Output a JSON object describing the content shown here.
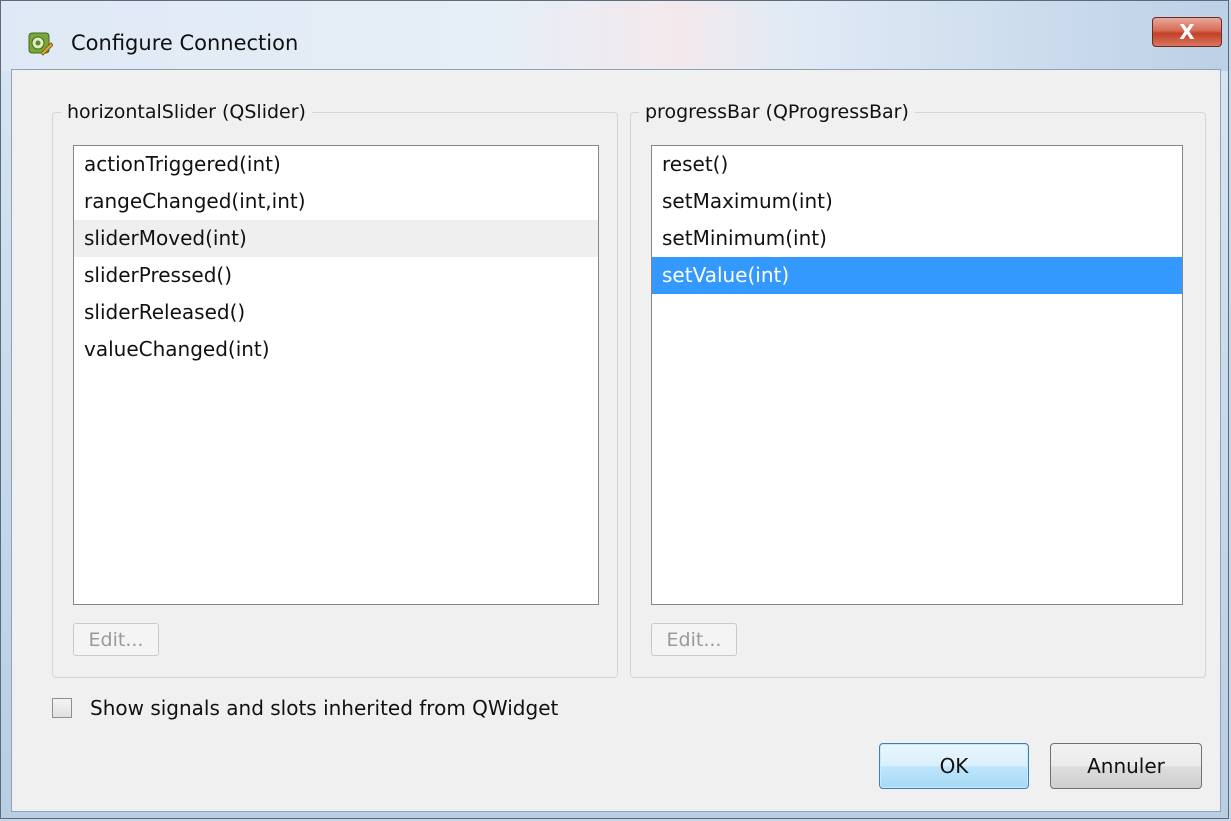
{
  "window": {
    "title": "Configure Connection",
    "close_label": "X"
  },
  "left_group": {
    "title": "horizontalSlider (QSlider)",
    "items": [
      "actionTriggered(int)",
      "rangeChanged(int,int)",
      "sliderMoved(int)",
      "sliderPressed()",
      "sliderReleased()",
      "valueChanged(int)"
    ],
    "hover_index": 2,
    "edit_label": "Edit..."
  },
  "right_group": {
    "title": "progressBar (QProgressBar)",
    "items": [
      "reset()",
      "setMaximum(int)",
      "setMinimum(int)",
      "setValue(int)"
    ],
    "selected_index": 3,
    "edit_label": "Edit..."
  },
  "options": {
    "show_inherited_label": "Show signals and slots inherited from QWidget",
    "show_inherited_checked": false
  },
  "buttons": {
    "ok_label": "OK",
    "cancel_label": "Annuler"
  },
  "colors": {
    "selection": "#3399ff",
    "hover": "#efefef"
  }
}
